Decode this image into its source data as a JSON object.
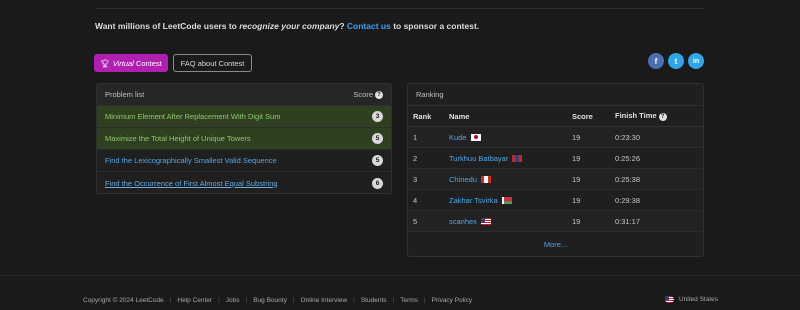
{
  "sponsor": {
    "text_a": "Want millions of LeetCode users to ",
    "text_em": "recognize your company",
    "text_b": "? ",
    "link": "Contact us",
    "text_c": " to sponsor a contest."
  },
  "buttons": {
    "virtual_icon": "trophy-icon",
    "virtual_em": "Virtual",
    "virtual_rest": "Contest",
    "faq": "FAQ about Contest"
  },
  "social": [
    {
      "icon": "facebook-icon",
      "glyph": "f"
    },
    {
      "icon": "twitter-icon",
      "glyph": "t"
    },
    {
      "icon": "linkedin-icon",
      "glyph": "in"
    }
  ],
  "problem_list": {
    "title": "Problem list",
    "score_label": "Score",
    "items": [
      {
        "title": "Minimum Element After Replacement With Digit Sum",
        "score": "3",
        "solved": true
      },
      {
        "title": "Maximize the Total Height of Unique Towers",
        "score": "5",
        "solved": true
      },
      {
        "title": "Find the Lexicographically Smallest Valid Sequence",
        "score": "5",
        "solved": false
      },
      {
        "title": "Find the Occurrence of First Almost Equal Substring",
        "score": "6",
        "solved": false
      }
    ]
  },
  "ranking": {
    "title": "Ranking",
    "columns": {
      "rank": "Rank",
      "name": "Name",
      "score": "Score",
      "time": "Finish Time"
    },
    "rows": [
      {
        "rank": "1",
        "name": "Kude",
        "flag": "jp",
        "score": "19",
        "time": "0:23:30"
      },
      {
        "rank": "2",
        "name": "Turkhuu Batbayar",
        "flag": "mn",
        "score": "19",
        "time": "0:25:26"
      },
      {
        "rank": "3",
        "name": "Chinedu",
        "flag": "ca",
        "score": "19",
        "time": "0:25:38"
      },
      {
        "rank": "4",
        "name": "Zakhar Tsvirka",
        "flag": "by",
        "score": "19",
        "time": "0:29:38"
      },
      {
        "rank": "5",
        "name": "scanhex",
        "flag": "us",
        "score": "19",
        "time": "0:31:17"
      }
    ],
    "more": "More..."
  },
  "footer": {
    "copyright": "Copyright © 2024 LeetCode",
    "links": [
      "Help Center",
      "Jobs",
      "Bug Bounty",
      "Online Interview",
      "Students",
      "Terms",
      "Privacy Policy"
    ],
    "region": "United States"
  },
  "colors": {
    "virtual_button": "#b01fb0",
    "link": "#3ea0f0",
    "solved_row": "#2f4020"
  }
}
